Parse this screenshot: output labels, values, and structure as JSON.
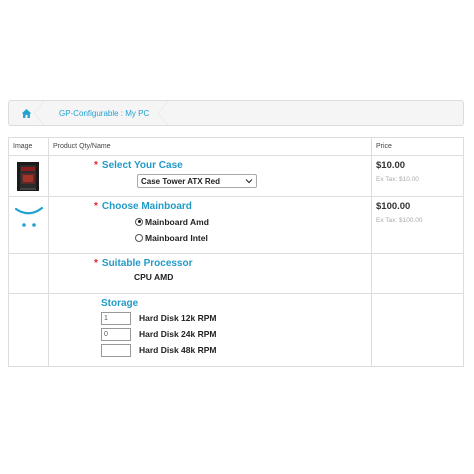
{
  "breadcrumb": {
    "home_icon": "home-icon",
    "link": "GP-Configurable : My PC"
  },
  "table": {
    "headers": {
      "image": "Image",
      "product": "Product Qty/Name",
      "price": "Price"
    },
    "case": {
      "title": "Select Your Case",
      "selected": "Case Tower ATX Red",
      "price": "$10.00",
      "extax": "Ex Tax: $10.00"
    },
    "mainboard": {
      "title": "Choose Mainboard",
      "options": [
        "Mainboard Amd",
        "Mainboard Intel"
      ],
      "selected_index": 0,
      "price": "$100.00",
      "extax": "Ex Tax: $100.00"
    },
    "processor": {
      "title": "Suitable Processor",
      "value": "CPU AMD"
    },
    "storage": {
      "title": "Storage",
      "items": [
        {
          "qty": "1",
          "label": "Hard Disk 12k RPM"
        },
        {
          "qty": "0",
          "label": "Hard Disk 24k RPM"
        },
        {
          "qty": "",
          "label": "Hard Disk 48k RPM"
        }
      ]
    }
  },
  "colors": {
    "accent": "#229ac8",
    "required": "#e0222b",
    "link": "#23a1d1"
  }
}
